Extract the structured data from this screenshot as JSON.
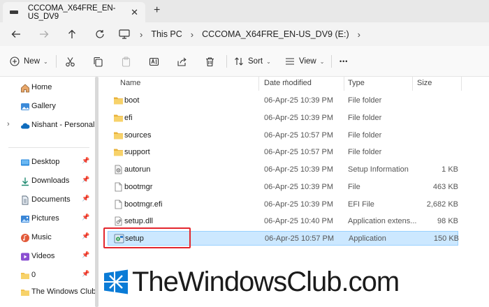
{
  "window": {
    "tab_title": "CCCOMA_X64FRE_EN-US_DV9",
    "tab_close": "✕",
    "new_tab": "+"
  },
  "address": {
    "pc_icon": "monitor-icon",
    "crumbs": [
      "This PC",
      "CCCOMA_X64FRE_EN-US_DV9 (E:)"
    ],
    "separator": "›"
  },
  "toolbar": {
    "new_label": "New",
    "sort_label": "Sort",
    "view_label": "View",
    "more_label": "•••",
    "caret": "⌄"
  },
  "sidebar": {
    "items": [
      {
        "label": "Home",
        "icon": "home-icon"
      },
      {
        "label": "Gallery",
        "icon": "gallery-icon"
      },
      {
        "label": "Nishant - Personal",
        "icon": "onedrive-icon",
        "expander": "›"
      },
      {
        "label": "Desktop",
        "icon": "desktop-icon",
        "pin": "📌"
      },
      {
        "label": "Downloads",
        "icon": "downloads-icon",
        "pin": "📌"
      },
      {
        "label": "Documents",
        "icon": "documents-icon",
        "pin": "📌"
      },
      {
        "label": "Pictures",
        "icon": "pictures-icon",
        "pin": "📌"
      },
      {
        "label": "Music",
        "icon": "music-icon",
        "pin": "📌"
      },
      {
        "label": "Videos",
        "icon": "videos-icon",
        "pin": "📌"
      },
      {
        "label": "0",
        "icon": "folder-icon",
        "pin": "📌"
      },
      {
        "label": "The Windows Club",
        "icon": "folder-icon"
      }
    ]
  },
  "columns": {
    "name": "Name",
    "date": "Date modified",
    "type": "Type",
    "size": "Size",
    "sort_indicator": "^"
  },
  "files": [
    {
      "name": "boot",
      "date": "06-Apr-25 10:39 PM",
      "type": "File folder",
      "size": "",
      "icon": "folder-icon"
    },
    {
      "name": "efi",
      "date": "06-Apr-25 10:39 PM",
      "type": "File folder",
      "size": "",
      "icon": "folder-icon"
    },
    {
      "name": "sources",
      "date": "06-Apr-25 10:57 PM",
      "type": "File folder",
      "size": "",
      "icon": "folder-icon"
    },
    {
      "name": "support",
      "date": "06-Apr-25 10:57 PM",
      "type": "File folder",
      "size": "",
      "icon": "folder-icon"
    },
    {
      "name": "autorun",
      "date": "06-Apr-25 10:39 PM",
      "type": "Setup Information",
      "size": "1 KB",
      "icon": "setup-info-icon"
    },
    {
      "name": "bootmgr",
      "date": "06-Apr-25 10:39 PM",
      "type": "File",
      "size": "463 KB",
      "icon": "file-icon"
    },
    {
      "name": "bootmgr.efi",
      "date": "06-Apr-25 10:39 PM",
      "type": "EFI File",
      "size": "2,682 KB",
      "icon": "file-icon"
    },
    {
      "name": "setup.dll",
      "date": "06-Apr-25 10:40 PM",
      "type": "Application extens...",
      "size": "98 KB",
      "icon": "dll-icon"
    },
    {
      "name": "setup",
      "date": "06-Apr-25 10:57 PM",
      "type": "Application",
      "size": "150 KB",
      "icon": "setup-app-icon",
      "selected": true
    }
  ],
  "watermark": {
    "text": "TheWindowsClub.com",
    "logo": "windows-logo-icon"
  },
  "colors": {
    "selection_bg": "#cce8ff",
    "selection_border": "#99d1ff",
    "highlight_box": "#e3262d",
    "folder": "#f2c14e",
    "accent": "#0067c0"
  }
}
